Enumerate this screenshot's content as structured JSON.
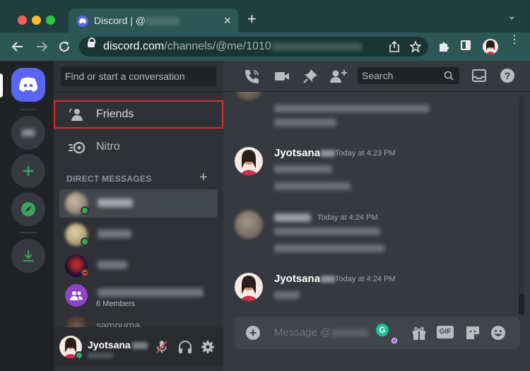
{
  "browser": {
    "tab_title": "Discord | @",
    "tab_close": "×",
    "new_tab": "+",
    "tab_menu": "⌄",
    "url_domain": "discord.com",
    "url_path": "/channels/@me/1010"
  },
  "sidebar": {
    "search_placeholder": "Find or start a conversation",
    "friends_label": "Friends",
    "nitro_label": "Nitro",
    "dm_header": "DIRECT MESSAGES",
    "dm_add": "+",
    "group_members": "6 Members",
    "partial_dm_name": "sampurna"
  },
  "user_panel": {
    "username": "Jyotsana"
  },
  "chat_header": {
    "search_placeholder": "Search",
    "help": "?"
  },
  "messages": [
    {
      "author": "Jyotsana",
      "time": "Today at 4:23 PM"
    },
    {
      "author": "",
      "time": "Today at 4:24 PM"
    },
    {
      "author": "Jyotsana",
      "time": "Today at 4:24 PM"
    }
  ],
  "composer": {
    "placeholder": "Message @",
    "add": "+",
    "gif": "GIF",
    "grammarly": "G"
  },
  "colors": {
    "blurple": "#5865f2",
    "online": "#3ba55d",
    "dnd": "#ed4245",
    "highlight_box": "#d32f2f"
  }
}
